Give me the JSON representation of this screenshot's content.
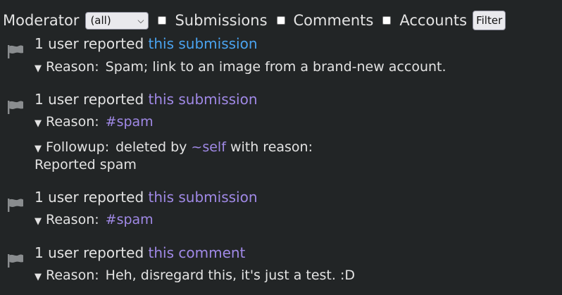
{
  "filter_bar": {
    "moderator_label": "Moderator",
    "moderator_value": "(all)",
    "submissions_label": "Submissions",
    "comments_label": "Comments",
    "accounts_label": "Accounts",
    "filter_button": "Filter"
  },
  "icons": {
    "flag": "flag-icon",
    "expand": "triangle-down-icon"
  },
  "colors": {
    "background": "#222526",
    "text": "#e3e3e3",
    "link_active": "#4aa3f0",
    "link_visited": "#a089e6"
  },
  "reports": [
    {
      "count_text": "1 user reported",
      "link": "this submission",
      "reason_label": "Reason:",
      "reason_text": "Spam; link to an image from a brand-new account."
    },
    {
      "count_text": "1 user reported",
      "link": "this submission",
      "reason_label": "Reason:",
      "reason_tag": "#spam",
      "followup_label": "Followup:",
      "followup_prefix": "deleted by",
      "followup_user": "~self",
      "followup_suffix": "with reason:",
      "followup_reason": "Reported spam"
    },
    {
      "count_text": "1 user reported",
      "link": "this submission",
      "reason_label": "Reason:",
      "reason_tag": "#spam"
    },
    {
      "count_text": "1 user reported",
      "link": "this comment",
      "reason_label": "Reason:",
      "reason_text": "Heh, disregard this, it's just a test. :D"
    }
  ]
}
